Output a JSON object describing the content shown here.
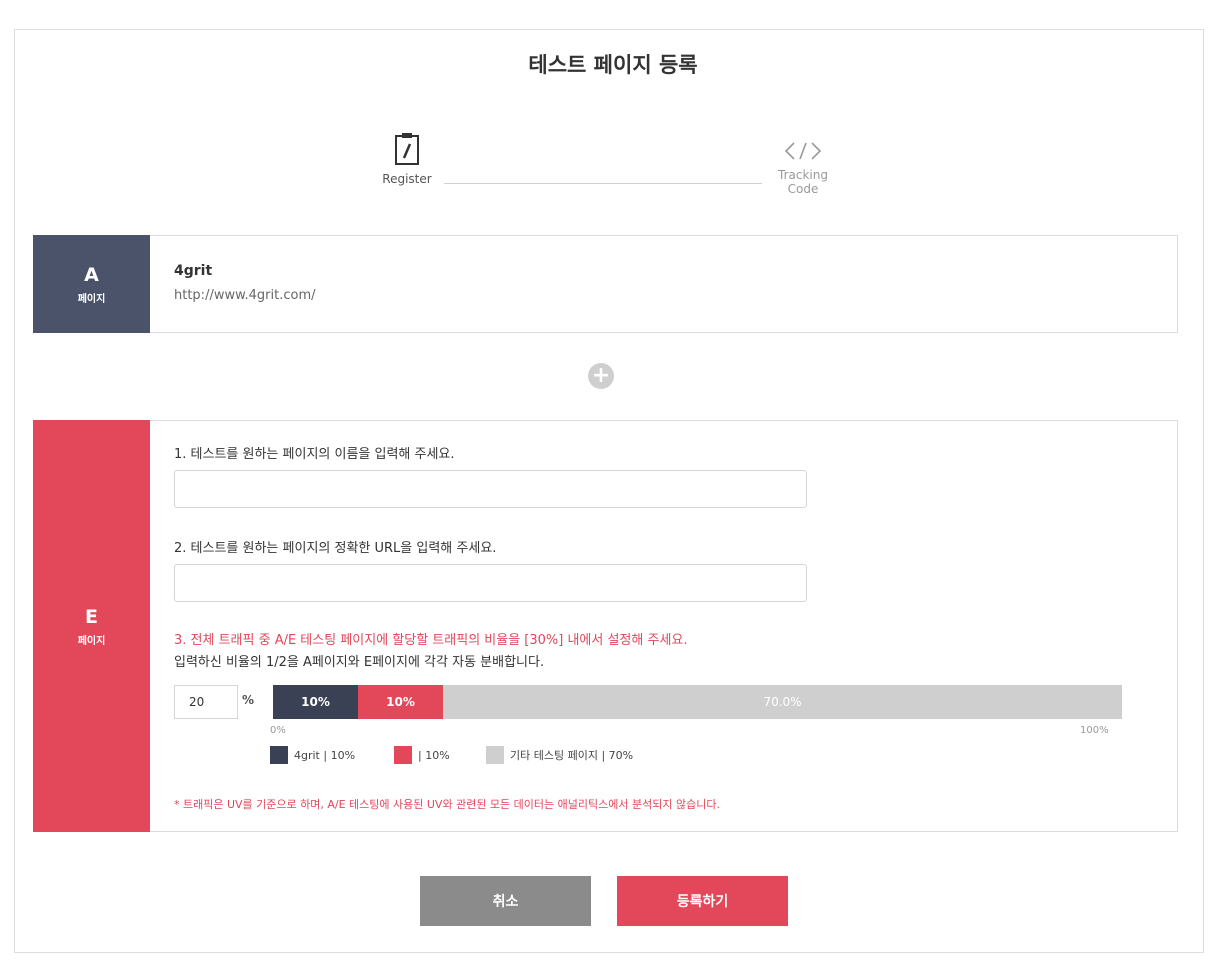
{
  "title": "테스트 페이지 등록",
  "stepper": {
    "register_label": "Register",
    "tracking_label_line1": "Tracking",
    "tracking_label_line2": "Code"
  },
  "page_a": {
    "letter": "A",
    "sub": "페이지",
    "name": "4grit",
    "url": "http://www.4grit.com/"
  },
  "page_e": {
    "letter": "E",
    "sub": "페이지",
    "q1": "1. 테스트를 원하는 페이지의 이름을 입력해 주세요.",
    "q1_value": "",
    "q2": "2. 테스트를 원하는 페이지의 정확한 URL을 입력해 주세요.",
    "q2_value": "",
    "q3": "3. 전체 트래픽 중 A/E 테스팅 페이지에 할당할 트래픽의 비율을 [30%] 내에서 설정해 주세요.",
    "q3_sub": "입력하신 비율의 1/2을 A페이지와 E페이지에 각각 자동 분배합니다.",
    "ratio_value": "20",
    "ratio_unit": "%",
    "bar": {
      "a_pct": 10,
      "e_pct": 10,
      "a_label": "10%",
      "e_label": "10%",
      "etc_label": "70.0%",
      "min_label": "0%",
      "max_label": "100%"
    },
    "legend": {
      "a": "4grit | 10%",
      "e": "| 10%",
      "etc": "기타 테스팅 페이지 | 70%"
    },
    "notice": "* 트래픽은 UV를 기준으로 하며, A/E 테스팅에 사용된 UV와 관련된 모든 데이터는 애널리틱스에서 분석되지 않습니다."
  },
  "buttons": {
    "cancel": "취소",
    "submit": "등록하기"
  },
  "colors": {
    "a_tag": "#4a5369",
    "e_tag": "#e2475a",
    "bar_a": "#3a4154",
    "bar_e": "#e2475a",
    "bar_etc": "#cfcfcf"
  }
}
